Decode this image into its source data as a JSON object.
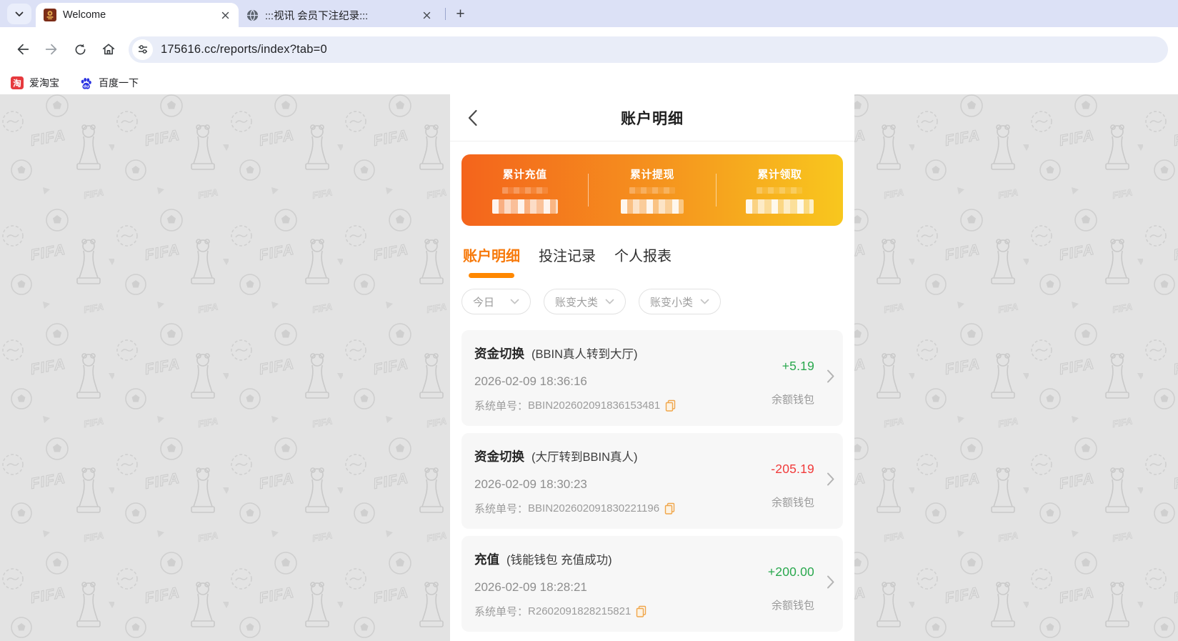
{
  "browser": {
    "tab1_title": "Welcome",
    "tab2_title": ":::视讯 会员下注纪录:::",
    "url": "175616.cc/reports/index?tab=0",
    "bookmark1": "爱淘宝",
    "bookmark2": "百度一下",
    "new_tab_glyph": "+"
  },
  "page": {
    "title": "账户明细",
    "summary": {
      "col1_label": "累计充值",
      "col2_label": "累计提现",
      "col3_label": "累计领取",
      "values_masked": true
    },
    "tabs": {
      "tab1": "账户明细",
      "tab2": "投注记录",
      "tab3": "个人报表",
      "active": "账户明细"
    },
    "filters": {
      "date": "今日",
      "category_major": "账变大类",
      "category_minor": "账变小类"
    },
    "records": [
      {
        "title": "资金切换",
        "detail": "(BBIN真人转到大厅)",
        "time": "2026-02-09 18:36:16",
        "order_label": "系统单号：",
        "order_no": "BBIN202602091836153481",
        "amount": "+5.19",
        "wallet": "余额钱包"
      },
      {
        "title": "资金切换",
        "detail": "(大厅转到BBIN真人)",
        "time": "2026-02-09 18:30:23",
        "order_label": "系统单号：",
        "order_no": "BBIN202602091830221196",
        "amount": "-205.19",
        "wallet": "余额钱包"
      },
      {
        "title": "充值",
        "detail": "(钱能钱包 充值成功)",
        "time": "2026-02-09 18:28:21",
        "order_label": "系统单号：",
        "order_no": "R2602091828215821",
        "amount": "+200.00",
        "wallet": "余额钱包"
      }
    ]
  },
  "colors": {
    "accent_orange": "#f7790a",
    "tab_underline": "#ff8800",
    "card_gradient_start": "#f4641c",
    "card_gradient_end": "#f8c71e",
    "amount_positive": "#2aa84e",
    "amount_negative": "#f13b3b",
    "tabstrip_bg": "#dce1f6"
  },
  "icons": {
    "tabstrip_caret": "chevron-down",
    "site_favicon": "casino-emblem",
    "second_tab": "globe",
    "nav": [
      "arrow-left",
      "arrow-right",
      "reload",
      "home"
    ],
    "omnibox": "tune-sliders",
    "bookmark1": "taobao-red-square",
    "bookmark2": "baidu-paw",
    "header_back": "chevron-left",
    "order_copy": "copy-pages",
    "row_arrow": "chevron-right"
  }
}
